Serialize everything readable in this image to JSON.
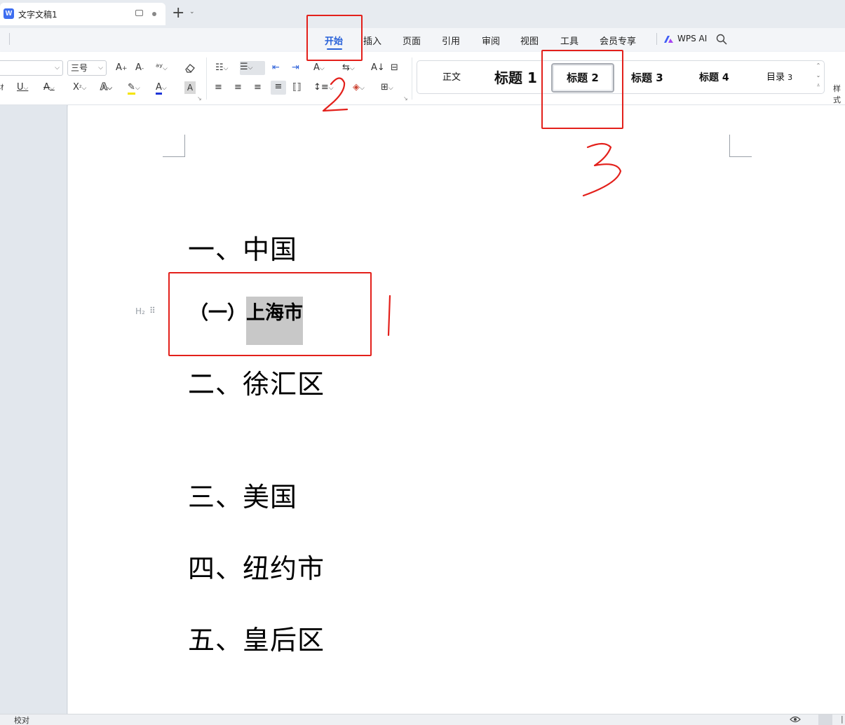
{
  "window": {
    "tab_title": "文字文稿1",
    "new_tab_symbol": "+"
  },
  "menu": {
    "items": [
      "开始",
      "插入",
      "页面",
      "引用",
      "审阅",
      "视图",
      "工具",
      "会员专享"
    ],
    "active": "开始",
    "ai_label": "WPS AI"
  },
  "ribbon": {
    "font_size": "三号",
    "style_gallery": {
      "items": [
        {
          "label": "正文",
          "num": ""
        },
        {
          "label": "标题",
          "num": "1"
        },
        {
          "label": "标题",
          "num": "2"
        },
        {
          "label": "标题",
          "num": "3"
        },
        {
          "label": "标题",
          "num": "4"
        },
        {
          "label": "目录",
          "num": "3"
        }
      ],
      "selected": "标题 2"
    },
    "styles_panel_label": "样式"
  },
  "document": {
    "heading1_items": [
      "一、中国",
      "二、徐汇区",
      "三、美国",
      "四、纽约市",
      "五、皇后区"
    ],
    "heading2_prefix": "（一）",
    "heading2_text": "上海市",
    "heading2_marker": "H₂"
  },
  "annotations": {
    "step1": "1",
    "step2": "2",
    "step3": "3",
    "color": "#e3201b"
  },
  "status": {
    "proofread": "校对"
  }
}
